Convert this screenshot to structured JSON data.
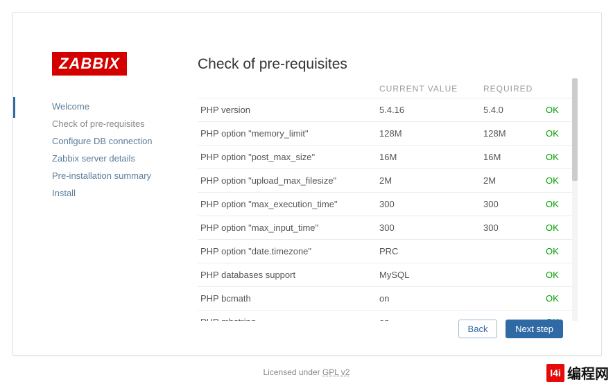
{
  "logo_text": "ZABBIX",
  "heading": "Check of pre-requisites",
  "nav": {
    "items": [
      {
        "label": "Welcome",
        "active": false
      },
      {
        "label": "Check of pre-requisites",
        "active": true
      },
      {
        "label": "Configure DB connection",
        "active": false
      },
      {
        "label": "Zabbix server details",
        "active": false
      },
      {
        "label": "Pre-installation summary",
        "active": false
      },
      {
        "label": "Install",
        "active": false
      }
    ]
  },
  "table": {
    "headers": {
      "name": "",
      "current": "CURRENT VALUE",
      "required": "REQUIRED",
      "status": ""
    },
    "rows": [
      {
        "name": "PHP version",
        "current": "5.4.16",
        "required": "5.4.0",
        "status": "OK"
      },
      {
        "name": "PHP option \"memory_limit\"",
        "current": "128M",
        "required": "128M",
        "status": "OK"
      },
      {
        "name": "PHP option \"post_max_size\"",
        "current": "16M",
        "required": "16M",
        "status": "OK"
      },
      {
        "name": "PHP option \"upload_max_filesize\"",
        "current": "2M",
        "required": "2M",
        "status": "OK"
      },
      {
        "name": "PHP option \"max_execution_time\"",
        "current": "300",
        "required": "300",
        "status": "OK"
      },
      {
        "name": "PHP option \"max_input_time\"",
        "current": "300",
        "required": "300",
        "status": "OK"
      },
      {
        "name": "PHP option \"date.timezone\"",
        "current": "PRC",
        "required": "",
        "status": "OK"
      },
      {
        "name": "PHP databases support",
        "current": "MySQL",
        "required": "",
        "status": "OK"
      },
      {
        "name": "PHP bcmath",
        "current": "on",
        "required": "",
        "status": "OK"
      },
      {
        "name": "PHP mbstring",
        "current": "on",
        "required": "",
        "status": "OK"
      }
    ]
  },
  "buttons": {
    "back": "Back",
    "next": "Next step"
  },
  "footer": {
    "licensed": "Licensed under ",
    "license": "GPL v2"
  },
  "brand_cn": {
    "sq": "I4i",
    "text": "编程网"
  }
}
